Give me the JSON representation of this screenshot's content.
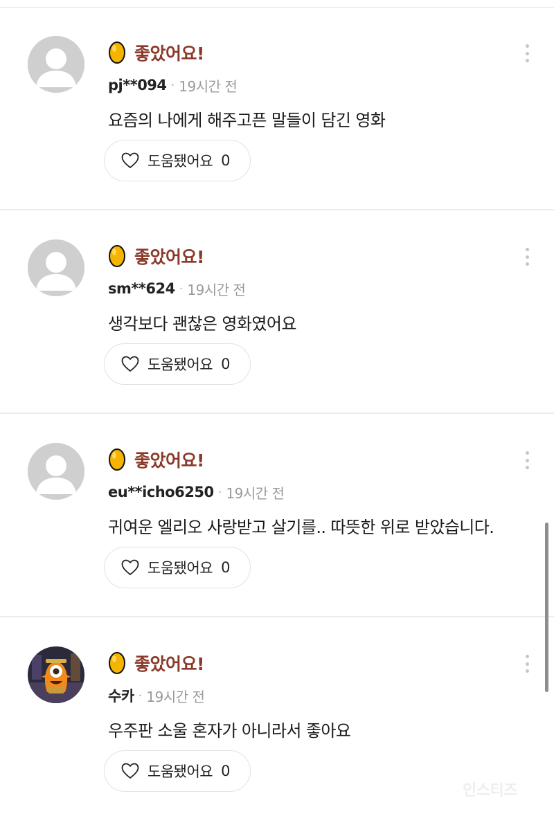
{
  "reviews": [
    {
      "rating_label": "좋았어요!",
      "username": "pj**094",
      "separator": "·",
      "time": "19시간 전",
      "text": "요즘의 나에게 해주고픈 말들이 담긴 영화",
      "helpful_label": "도움됐어요",
      "helpful_count": "0",
      "avatar": "default"
    },
    {
      "rating_label": "좋았어요!",
      "username": "sm**624",
      "separator": "·",
      "time": "19시간 전",
      "text": "생각보다 괜찮은 영화였어요",
      "helpful_label": "도움됐어요",
      "helpful_count": "0",
      "avatar": "default"
    },
    {
      "rating_label": "좋았어요!",
      "username": "eu**icho6250",
      "separator": "·",
      "time": "19시간 전",
      "text": "귀여운 엘리오 사랑받고 살기를.. 따뜻한 위로 받았습니다.",
      "helpful_label": "도움됐어요",
      "helpful_count": "0",
      "avatar": "default"
    },
    {
      "rating_label": "좋았어요!",
      "username": "수카",
      "separator": "·",
      "time": "19시간 전",
      "text": "우주판 소울 혼자가 아니라서 좋아요",
      "helpful_label": "도움됐어요",
      "helpful_count": "0",
      "avatar": "character"
    }
  ],
  "watermark": "인스티즈",
  "colors": {
    "rating_text": "#8a3a2a",
    "egg": "#f4b400",
    "egg_outline": "#111111",
    "divider": "#ececec",
    "time_gray": "#9a9a9a"
  },
  "icons": {
    "rating": "golden-egg-icon",
    "helpful": "heart-outline-icon",
    "more": "more-vertical-icon",
    "avatar": "default-avatar-icon"
  }
}
